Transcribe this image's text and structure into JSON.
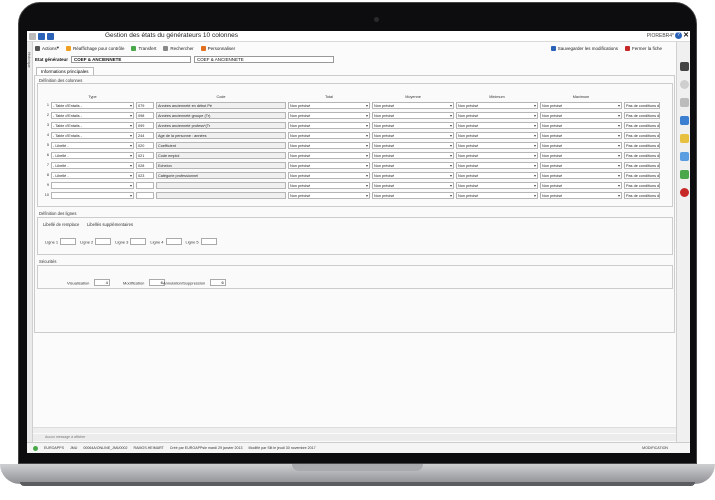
{
  "window": {
    "title": "Gestion des états du générateurs 10 colonnes",
    "user": "PIOREBR4*"
  },
  "toolbar": {
    "actions": "Actions",
    "refresh": "Réaffichage pour contrôle",
    "transfer": "Transfert",
    "search": "Rechercher",
    "customize": "Personnaliser",
    "save": "Sauvegarder les modifications",
    "close": "Fermer la fiche"
  },
  "header": {
    "label": "Etat générateur",
    "code": "COEF & ANCIENNETE",
    "desc": "COEF & ANCIENNETE"
  },
  "tabs": [
    "Informations principales"
  ],
  "sidebar_label": "Historique",
  "columns_section": {
    "title": "Définition des colonnes",
    "headers": [
      "Type",
      "Code",
      "Total",
      "Moyenne",
      "Minimum",
      "Maximum"
    ],
    "rows": [
      {
        "num": "1",
        "type": "- Table d'Entalis -",
        "code": "079",
        "desc": "Années ancienneté en début Pé",
        "total": "Non précisé",
        "moy": "Non précisé",
        "min": "Non précisé",
        "max": "Non précisé",
        "cond": "Pas de conditions d"
      },
      {
        "num": "2",
        "type": "- Table d'Entalis -",
        "code": "098",
        "desc": "Années ancienneté groupe (Tr)",
        "total": "Non précisé",
        "moy": "Non précisé",
        "min": "Non précisé",
        "max": "Non précisé",
        "cond": "Pas de conditions d"
      },
      {
        "num": "3",
        "type": "- Table d'Entalis -",
        "code": "099",
        "desc": "Années ancienneté profess*(Tr",
        "total": "Non précisé",
        "moy": "Non précisé",
        "min": "Non précisé",
        "max": "Non précisé",
        "cond": "Pas de conditions d"
      },
      {
        "num": "4",
        "type": "- Table d'Entalis -",
        "code": "244",
        "desc": "Age de la personne : années",
        "total": "Non précisé",
        "moy": "Non précisé",
        "min": "Non précisé",
        "max": "Non précisé",
        "cond": "Pas de conditions d"
      },
      {
        "num": "5",
        "type": "- Libellé -",
        "code": "020",
        "desc": "Coefficient",
        "total": "Non précisé",
        "moy": "Non précisé",
        "min": "Non précisé",
        "max": "Non précisé",
        "cond": "Pas de conditions d"
      },
      {
        "num": "6",
        "type": "- Libellé -",
        "code": "021",
        "desc": "Code emploi",
        "total": "Non précisé",
        "moy": "Non précisé",
        "min": "Non précisé",
        "max": "Non précisé",
        "cond": "Pas de conditions d"
      },
      {
        "num": "7",
        "type": "- Libellé -",
        "code": "028",
        "desc": "Echelon",
        "total": "Non précisé",
        "moy": "Non précisé",
        "min": "Non précisé",
        "max": "Non précisé",
        "cond": "Pas de conditions d"
      },
      {
        "num": "8",
        "type": "- Libellé -",
        "code": "023",
        "desc": "Catégorie professionnel",
        "total": "Non précisé",
        "moy": "Non précisé",
        "min": "Non précisé",
        "max": "Non précisé",
        "cond": "Pas de conditions d"
      },
      {
        "num": "9",
        "type": "",
        "code": "",
        "desc": "",
        "total": "Non précisé",
        "moy": "Non précisé",
        "min": "Non précisé",
        "max": "Non précisé",
        "cond": "Pas de conditions d"
      },
      {
        "num": "10",
        "type": "",
        "code": "",
        "desc": "",
        "total": "Non précisé",
        "moy": "Non précisé",
        "min": "Non précisé",
        "max": "Non précisé",
        "cond": "Pas de conditions d"
      }
    ]
  },
  "lines_section": {
    "title": "Définition des lignes",
    "group1": "Libellé de remplace",
    "group2": "Libellés supplémentaires",
    "fields": [
      "Ligne 1",
      "Ligne 2",
      "Ligne 3",
      "Ligne 4",
      "Ligne 5"
    ]
  },
  "security": {
    "title": "Sécurités",
    "visu_label": "Visualisation",
    "visu_val": "4",
    "modif_label": "Modification",
    "modif_val": "6",
    "annul_label": "Annulation/Suppression",
    "annul_val": "6"
  },
  "message": "Aucun message à afficher",
  "status": {
    "company": "EUROAPPS",
    "code": "JMU",
    "path": "00064A/ONLINE_JMU0002",
    "user": "RAMOS.HEIMART",
    "created": "Créé par EUROAPPsle mardi 29 janvier 2013",
    "modified": "Modifié par Slit le jeudi 30 novembre 2017",
    "mode": "MODIFICATION"
  },
  "colors": {
    "accent": "#2a62b8",
    "danger": "#c62828",
    "ok": "#4aa84a"
  }
}
